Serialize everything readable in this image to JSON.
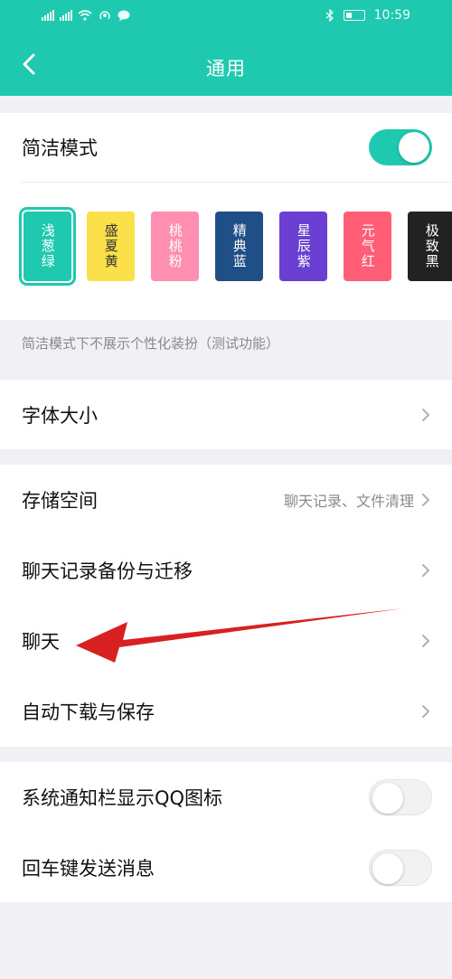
{
  "status_bar": {
    "time": "10:59"
  },
  "header": {
    "title": "通用",
    "back_icon": "chevron-left-icon"
  },
  "concise_mode": {
    "label": "简洁模式",
    "enabled": true,
    "themes": [
      {
        "name": "浅葱绿",
        "color": "#1ec9b0",
        "text_color": "#ffffff",
        "selected": true
      },
      {
        "name": "盛夏黄",
        "color": "#fbe04a",
        "text_color": "#333333",
        "selected": false
      },
      {
        "name": "桃桃粉",
        "color": "#ff8fb0",
        "text_color": "#ffffff",
        "selected": false
      },
      {
        "name": "精典蓝",
        "color": "#1f4f86",
        "text_color": "#ffffff",
        "selected": false
      },
      {
        "name": "星辰紫",
        "color": "#6a3fd1",
        "text_color": "#ffffff",
        "selected": false
      },
      {
        "name": "元气红",
        "color": "#ff5e74",
        "text_color": "#ffffff",
        "selected": false
      },
      {
        "name": "极致黑",
        "color": "#222222",
        "text_color": "#ffffff",
        "selected": false
      }
    ],
    "hint": "简洁模式下不展示个性化装扮（测试功能）"
  },
  "font_size": {
    "label": "字体大小"
  },
  "storage": {
    "label": "存储空间",
    "value": "聊天记录、文件清理"
  },
  "backup": {
    "label": "聊天记录备份与迁移"
  },
  "chat": {
    "label": "聊天"
  },
  "auto_download": {
    "label": "自动下载与保存"
  },
  "notif_icon": {
    "label": "系统通知栏显示QQ图标",
    "enabled": false
  },
  "enter_send": {
    "label": "回车键发送消息",
    "enabled": false
  },
  "colors": {
    "accent": "#1ec9b0",
    "annotation_arrow": "#d92020"
  }
}
